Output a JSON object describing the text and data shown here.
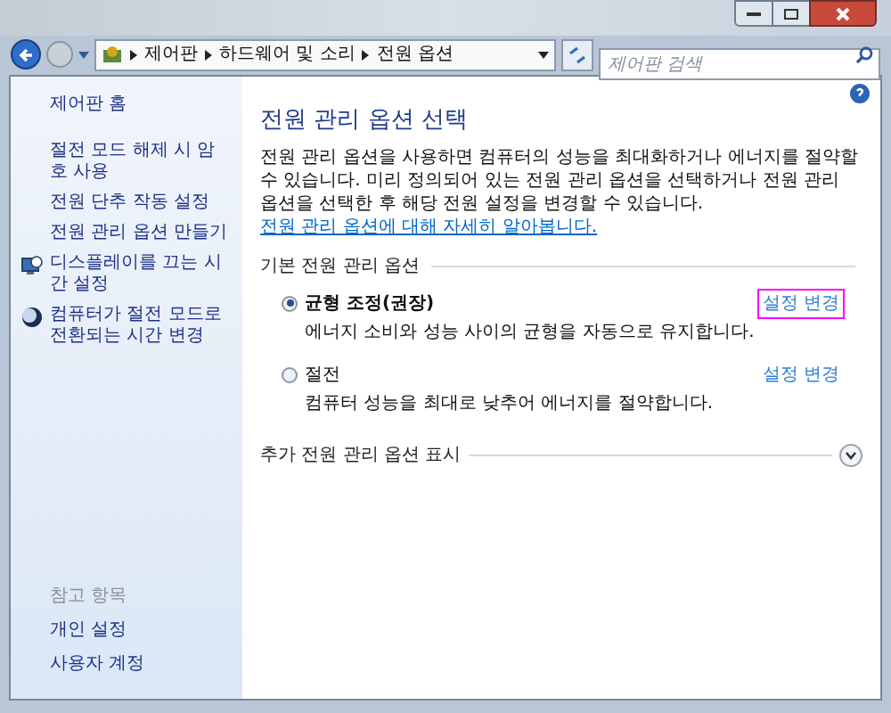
{
  "address_bar": {
    "breadcrumb": [
      "제어판",
      "하드웨어 및 소리",
      "전원 옵션"
    ]
  },
  "search": {
    "placeholder": "제어판 검색"
  },
  "sidebar": {
    "home": "제어판 홈",
    "links": [
      {
        "label": "절전 모드 해제 시 암호 사용",
        "kind": "plain"
      },
      {
        "label": "전원 단추 작동 설정",
        "kind": "plain"
      },
      {
        "label": "전원 관리 옵션 만들기",
        "kind": "plain"
      },
      {
        "label": "디스플레이를 끄는 시간 설정",
        "kind": "monitor"
      },
      {
        "label": "컴퓨터가 절전 모드로 전환되는 시간 변경",
        "kind": "moon"
      }
    ],
    "see_also": {
      "title": "참고 항목",
      "items": [
        "개인 설정",
        "사용자 계정"
      ]
    }
  },
  "main": {
    "title": "전원 관리 옵션 선택",
    "description": "전원 관리 옵션을 사용하면 컴퓨터의 성능을 최대화하거나 에너지를 절약할 수 있습니다. 미리 정의되어 있는 전원 관리 옵션을 선택하거나 전원 관리 옵션을 선택한 후 해당 전원 설정을 변경할 수 있습니다.",
    "learn_more": "전원 관리 옵션에 대해 자세히 알아봅니다.",
    "section": "기본 전원 관리 옵션",
    "plans": [
      {
        "name": "균형 조정(권장)",
        "description": "에너지 소비와 성능 사이의 균형을 자동으로 유지합니다.",
        "selected": true,
        "action": "설정 변경",
        "highlighted": true
      },
      {
        "name": "절전",
        "description": "컴퓨터 성능을 최대로 낮추어 에너지를 절약합니다.",
        "selected": false,
        "action": "설정 변경",
        "highlighted": false
      }
    ],
    "more": "추가 전원 관리 옵션 표시"
  }
}
